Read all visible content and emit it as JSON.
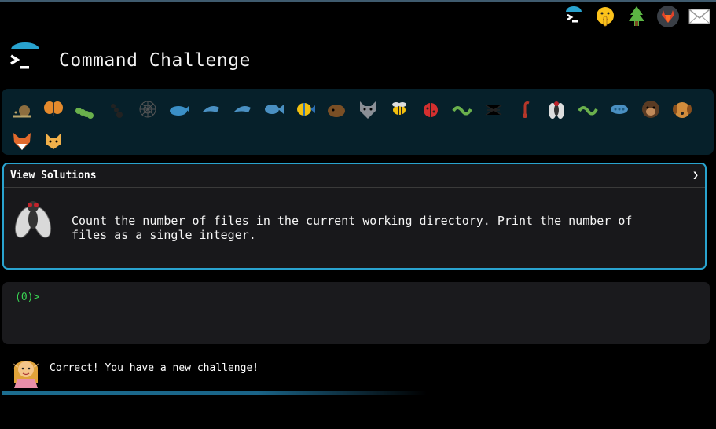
{
  "header": {
    "title": "Command Challenge",
    "top_icons": [
      "terminal-icon",
      "shushing-face-icon",
      "tree-icon",
      "gitlab-icon",
      "envelope-icon"
    ]
  },
  "badges": [
    "snail",
    "butterfly",
    "caterpillar",
    "ant",
    "spider-web",
    "whale",
    "dolphin",
    "dolphin",
    "fish",
    "tropical-fish",
    "hedgehog",
    "wolf",
    "bee",
    "ladybug",
    "worm",
    "spider",
    "scorpion",
    "fly",
    "worm",
    "microbe",
    "gorilla",
    "dog",
    "fox",
    "cat"
  ],
  "challenge": {
    "solutions_label": "View Solutions",
    "chevron": "❯",
    "description": "Count the number of files in the current working directory. Print the number of files as a single integer."
  },
  "terminal": {
    "prompt": "(0)>"
  },
  "status": {
    "message": "Correct! You have a new challenge!",
    "progress": 1.0
  },
  "colors": {
    "accent": "#29a3cf",
    "prompt": "#39d353",
    "badge_bg": "#06202a",
    "panel_bg": "#18181b"
  }
}
